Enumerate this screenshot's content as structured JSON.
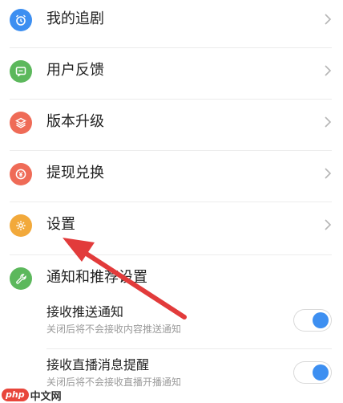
{
  "menu": {
    "items": [
      {
        "label": "我的追剧",
        "icon": "alarm-clock-icon",
        "color": "#3d8ff1"
      },
      {
        "label": "用户反馈",
        "icon": "feedback-icon",
        "color": "#5cb85c"
      },
      {
        "label": "版本升级",
        "icon": "layers-icon",
        "color": "#ef6b57"
      },
      {
        "label": "提现兑换",
        "icon": "yuan-coin-icon",
        "color": "#ef6b57"
      },
      {
        "label": "设置",
        "icon": "gear-icon",
        "color": "#f2a93b"
      }
    ]
  },
  "notifications": {
    "title": "通知和推荐设置",
    "icon": "wrench-icon",
    "color": "#5cb85c",
    "items": [
      {
        "title": "接收推送通知",
        "desc": "关闭后将不会接收内容推送通知",
        "enabled": true
      },
      {
        "title": "接收直播消息提醒",
        "desc": "关闭后将不会接收直播开播通知",
        "enabled": true
      }
    ]
  },
  "watermark": {
    "php": "php",
    "site": "中文网"
  },
  "colors": {
    "toggle_on": "#3d8ff1",
    "arrow": "#e23b3b"
  }
}
